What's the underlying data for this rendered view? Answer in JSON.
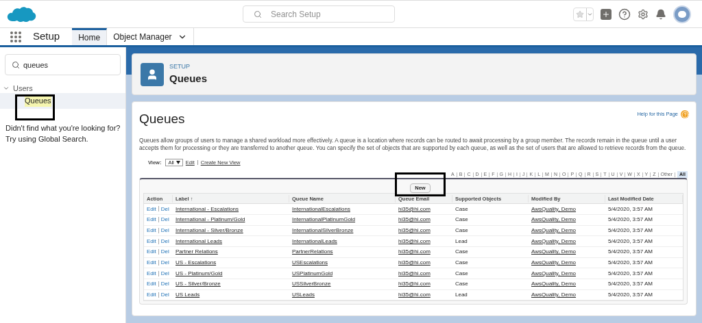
{
  "header": {
    "search": {
      "placeholder": "Search Setup"
    }
  },
  "nav": {
    "app_name": "Setup",
    "tabs": [
      {
        "label": "Home",
        "selected": true
      },
      {
        "label": "Object Manager",
        "selected": false
      }
    ]
  },
  "sidebar": {
    "search": {
      "value": "queues"
    },
    "tree": [
      {
        "label": "Users",
        "expanded": true,
        "children": [
          {
            "label": "Queues",
            "selected": true
          }
        ]
      }
    ],
    "hint": [
      "Didn't find what you're looking for?",
      "Try using Global Search."
    ]
  },
  "page_header": {
    "eyebrow": "SETUP",
    "title": "Queues"
  },
  "content": {
    "title": "Queues",
    "help_link": "Help for this Page",
    "description": "Queues allow groups of users to manage a shared workload more effectively. A queue is a location where records can be routed to await processing by a group member. The records remain in the queue until a user accepts them for processing or they are transferred to another queue. You can specify the set of objects that are supported by each queue, as well as the set of users that are allowed to retrieve records from the queue.",
    "view": {
      "label": "View:",
      "value": "All",
      "links": [
        "Edit",
        "Create New View"
      ]
    },
    "letters": [
      {
        "label": "A",
        "selected": false
      },
      {
        "label": "B",
        "selected": false
      },
      {
        "label": "C",
        "selected": false
      },
      {
        "label": "D",
        "selected": false
      },
      {
        "label": "E",
        "selected": false
      },
      {
        "label": "F",
        "selected": false
      },
      {
        "label": "G",
        "selected": false
      },
      {
        "label": "H",
        "selected": false
      },
      {
        "label": "I",
        "selected": false
      },
      {
        "label": "J",
        "selected": false
      },
      {
        "label": "K",
        "selected": false
      },
      {
        "label": "L",
        "selected": false
      },
      {
        "label": "M",
        "selected": false
      },
      {
        "label": "N",
        "selected": false
      },
      {
        "label": "O",
        "selected": false
      },
      {
        "label": "P",
        "selected": false
      },
      {
        "label": "Q",
        "selected": false
      },
      {
        "label": "R",
        "selected": false
      },
      {
        "label": "S",
        "selected": false
      },
      {
        "label": "T",
        "selected": false
      },
      {
        "label": "U",
        "selected": false
      },
      {
        "label": "V",
        "selected": false
      },
      {
        "label": "W",
        "selected": false
      },
      {
        "label": "X",
        "selected": false
      },
      {
        "label": "Y",
        "selected": false
      },
      {
        "label": "Z",
        "selected": false
      },
      {
        "label": "Other",
        "selected": false
      },
      {
        "label": "All",
        "selected": true
      }
    ],
    "new_button": "New",
    "table": {
      "columns": [
        "Action",
        "Label ↑",
        "Queue Name",
        "Queue Email",
        "Supported Objects",
        "Modified By",
        "Last Modified Date"
      ],
      "rows": [
        {
          "actions": [
            "Edit",
            "Del"
          ],
          "label": "International - Escalations",
          "queue_name": "InternationalEscalations",
          "email": "hi35@hi.com",
          "objects": "Case",
          "modified_by": "AwsQuality, Demo",
          "date": "5/4/2020, 3:57 AM"
        },
        {
          "actions": [
            "Edit",
            "Del"
          ],
          "label": "International - Platinum/Gold",
          "queue_name": "InternationalPlatinumGold",
          "email": "hi35@hi.com",
          "objects": "Case",
          "modified_by": "AwsQuality, Demo",
          "date": "5/4/2020, 3:57 AM"
        },
        {
          "actions": [
            "Edit",
            "Del"
          ],
          "label": "International - Silver/Bronze",
          "queue_name": "InternationalSilverBronze",
          "email": "hi35@hi.com",
          "objects": "Case",
          "modified_by": "AwsQuality, Demo",
          "date": "5/4/2020, 3:57 AM"
        },
        {
          "actions": [
            "Edit",
            "Del"
          ],
          "label": "International Leads",
          "queue_name": "InternationalLeads",
          "email": "hi35@hi.com",
          "objects": "Lead",
          "modified_by": "AwsQuality, Demo",
          "date": "5/4/2020, 3:57 AM"
        },
        {
          "actions": [
            "Edit",
            "Del"
          ],
          "label": "Partner Relations",
          "queue_name": "PartnerRelations",
          "email": "hi35@hi.com",
          "objects": "Case",
          "modified_by": "AwsQuality, Demo",
          "date": "5/4/2020, 3:57 AM"
        },
        {
          "actions": [
            "Edit",
            "Del"
          ],
          "label": "US - Escalations",
          "queue_name": "USEscalations",
          "email": "hi35@hi.com",
          "objects": "Case",
          "modified_by": "AwsQuality, Demo",
          "date": "5/4/2020, 3:57 AM"
        },
        {
          "actions": [
            "Edit",
            "Del"
          ],
          "label": "US - Platinum/Gold",
          "queue_name": "USPlatinumGold",
          "email": "hi35@hi.com",
          "objects": "Case",
          "modified_by": "AwsQuality, Demo",
          "date": "5/4/2020, 3:57 AM"
        },
        {
          "actions": [
            "Edit",
            "Del"
          ],
          "label": "US - Silver/Bronze",
          "queue_name": "USSilverBronze",
          "email": "hi35@hi.com",
          "objects": "Case",
          "modified_by": "AwsQuality, Demo",
          "date": "5/4/2020, 3:57 AM"
        },
        {
          "actions": [
            "Edit",
            "Del"
          ],
          "label": "US Leads",
          "queue_name": "USLeads",
          "email": "hi35@hi.com",
          "objects": "Lead",
          "modified_by": "AwsQuality, Demo",
          "date": "5/4/2020, 3:57 AM"
        }
      ]
    }
  }
}
